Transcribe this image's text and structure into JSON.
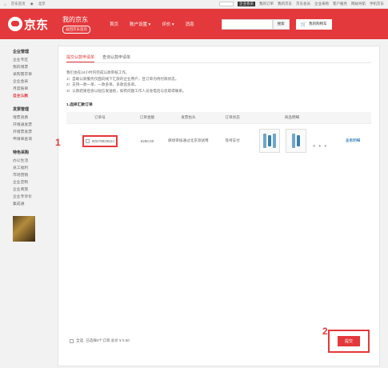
{
  "topbar": {
    "home": "京东首页",
    "location": "北京",
    "links": [
      "我的订单",
      "我的京东",
      "京东会员",
      "企业采购",
      "客户服务",
      "网站导航",
      "手机京东"
    ],
    "badge": "企业会员"
  },
  "header": {
    "brand": "京东",
    "myjd_title": "我的京东",
    "return_home": "返回京东首页",
    "nav": [
      "首页",
      "账户设置 ▾",
      "评价 ▾",
      "消息"
    ],
    "search_btn": "搜索",
    "cart": "我的购物车"
  },
  "sidebar": {
    "groups": [
      {
        "title": "企业管理",
        "items": [
          "企业专区",
          "我的增票",
          "采购需求单",
          "企业金采",
          "月度账单",
          "自主认款"
        ]
      },
      {
        "title": "发票管理",
        "items": [
          "增票资质",
          "开增通发票",
          "开增票发票",
          "申请单查询"
        ]
      },
      {
        "title": "特色采购",
        "items": [
          "办公生活",
          "员工福利",
          "市场营销",
          "企业定制",
          "企业商旅",
          "企业专享价",
          "集成通"
        ]
      }
    ],
    "active": "自主认款"
  },
  "tabs": [
    "提交认款申请单",
    "查询认款申请单"
  ],
  "notes": [
    "我们会在24小时内完成认款审核工作。",
    "1）自助认款服务仅面向线下汇款的企业用户，且订单为待付款状态。",
    "2）支持一款一单、一款多单，多款追多单。",
    "3）认款结果后会以短信发送给，如有问题工作人员会电话与您取得联系。"
  ],
  "section_title": "1.选择汇款订单",
  "table": {
    "headers": [
      "订单号",
      "订单金额",
      "发票抬头",
      "订单状态",
      "商品明细",
      ""
    ],
    "rows": [
      {
        "order_no": "80578925524",
        "amount": "¥260.00",
        "invoice": "麻烦审核通过北京测试用",
        "status": "等待支付",
        "more": "• • •",
        "view": "查看明细"
      }
    ]
  },
  "footer": {
    "select_all": "全选",
    "summary": "已选择0个订单,总价 ¥ 0.00",
    "submit": "提交"
  },
  "markers": {
    "one": "1",
    "two": "2"
  }
}
